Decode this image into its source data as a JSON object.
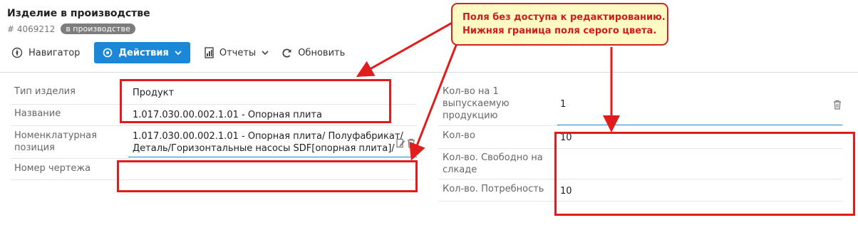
{
  "header": {
    "title": "Изделие в производстве",
    "id": "# 4069212",
    "status": "в производстве"
  },
  "toolbar": {
    "navigator": "Навигатор",
    "actions": "Действия",
    "reports": "Отчеты",
    "refresh": "Обновить"
  },
  "left": {
    "product_type_label": "Тип изделия",
    "product_type_value": "Продукт",
    "name_label": "Название",
    "name_value": "1.017.030.00.002.1.01 - Опорная плита",
    "nomenclature_label_1": "Номенклатурная",
    "nomenclature_label_2": "позиция",
    "nomenclature_value_1": "1.017.030.00.002.1.01 - Опорная плита/ Полуфабрикат/",
    "nomenclature_value_2": "Деталь/Горизонтальные насосы SDF[опорная плита]/",
    "drawing_label": "Номер чертежа",
    "drawing_value": ""
  },
  "right": {
    "qty_per_unit_label_1": "Кол-во на 1",
    "qty_per_unit_label_2": "выпускаемую",
    "qty_per_unit_label_3": "продукцию",
    "qty_per_unit_value": "1",
    "qty_label": "Кол-во",
    "qty_value": "10",
    "free_stock_label_1": "Кол-во. Свободно на",
    "free_stock_label_2": "слкаде",
    "free_stock_value": "",
    "need_label": "Кол-во. Потребность",
    "need_value": "10"
  },
  "annotation": {
    "line1": "Поля без доступа к редактированию.",
    "line2": "Нижняя граница поля серого цвета."
  },
  "colors": {
    "accent": "#1a88d6",
    "annotation_red": "#e01c1c",
    "callout_bg": "#fff9c4"
  },
  "icons": [
    "compass-icon",
    "target-icon",
    "chevron-down-icon",
    "report-icon",
    "refresh-icon",
    "edit-icon",
    "trash-icon"
  ]
}
